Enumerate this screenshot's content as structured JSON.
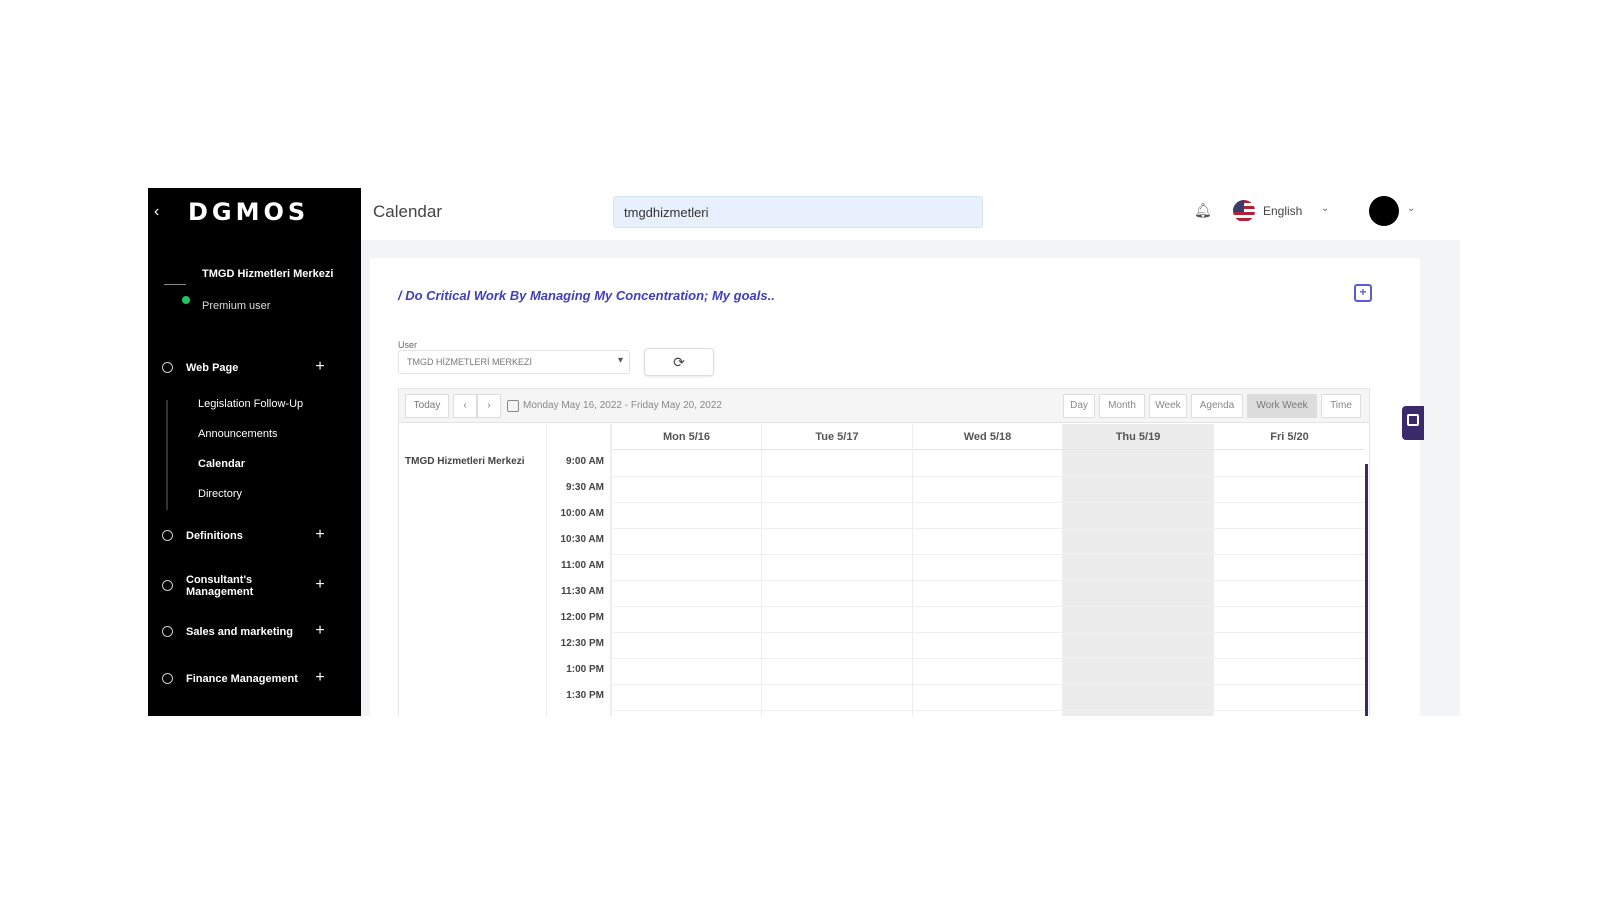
{
  "app": {
    "logo": "DGMOS",
    "page_title": "Calendar",
    "search_value": "tmgdhizmetleri",
    "language": "English"
  },
  "user": {
    "name": "TMGD Hizmetleri Merkezi",
    "plan": "Premium user"
  },
  "sidebar": {
    "items": [
      {
        "label": "Web Page",
        "icon": "circle-icon"
      },
      {
        "label": "Definitions",
        "icon": "circle-icon"
      },
      {
        "label": "Consultant's Management",
        "icon": "circle-icon"
      },
      {
        "label": "Sales and marketing",
        "icon": "circle-icon"
      },
      {
        "label": "Finance Management",
        "icon": "circle-icon"
      }
    ],
    "sub_items": [
      {
        "label": "Legislation Follow-Up"
      },
      {
        "label": "Announcements"
      },
      {
        "label": "Calendar"
      },
      {
        "label": "Directory"
      }
    ]
  },
  "content": {
    "goal_text": "/ Do Critical Work By Managing My Concentration; My goals..",
    "user_label": "User",
    "user_select_value": "TMGD HİZMETLERİ MERKEZİ",
    "refresh_icon": "refresh-icon"
  },
  "scheduler": {
    "today_label": "Today",
    "prev_label": "‹",
    "next_label": "›",
    "date_range": "Monday May 16, 2022 - Friday May 20, 2022",
    "views": [
      "Day",
      "Month",
      "Week",
      "Agenda",
      "Work Week",
      "Time"
    ],
    "active_view": "Work Week",
    "resource": "TMGD Hizmetleri Merkezi",
    "days": [
      "Mon 5/16",
      "Tue 5/17",
      "Wed 5/18",
      "Thu 5/19",
      "Fri 5/20"
    ],
    "today_day": "Thu 5/19",
    "times": [
      "9:00 AM",
      "9:30 AM",
      "10:00 AM",
      "10:30 AM",
      "11:00 AM",
      "11:30 AM",
      "12:00 PM",
      "12:30 PM",
      "1:00 PM",
      "1:30 PM"
    ]
  },
  "colors": {
    "sidebar_bg": "#000000",
    "accent": "#3f3fbf",
    "now_line": "#3b2a6b",
    "today_column": "#ececec"
  }
}
